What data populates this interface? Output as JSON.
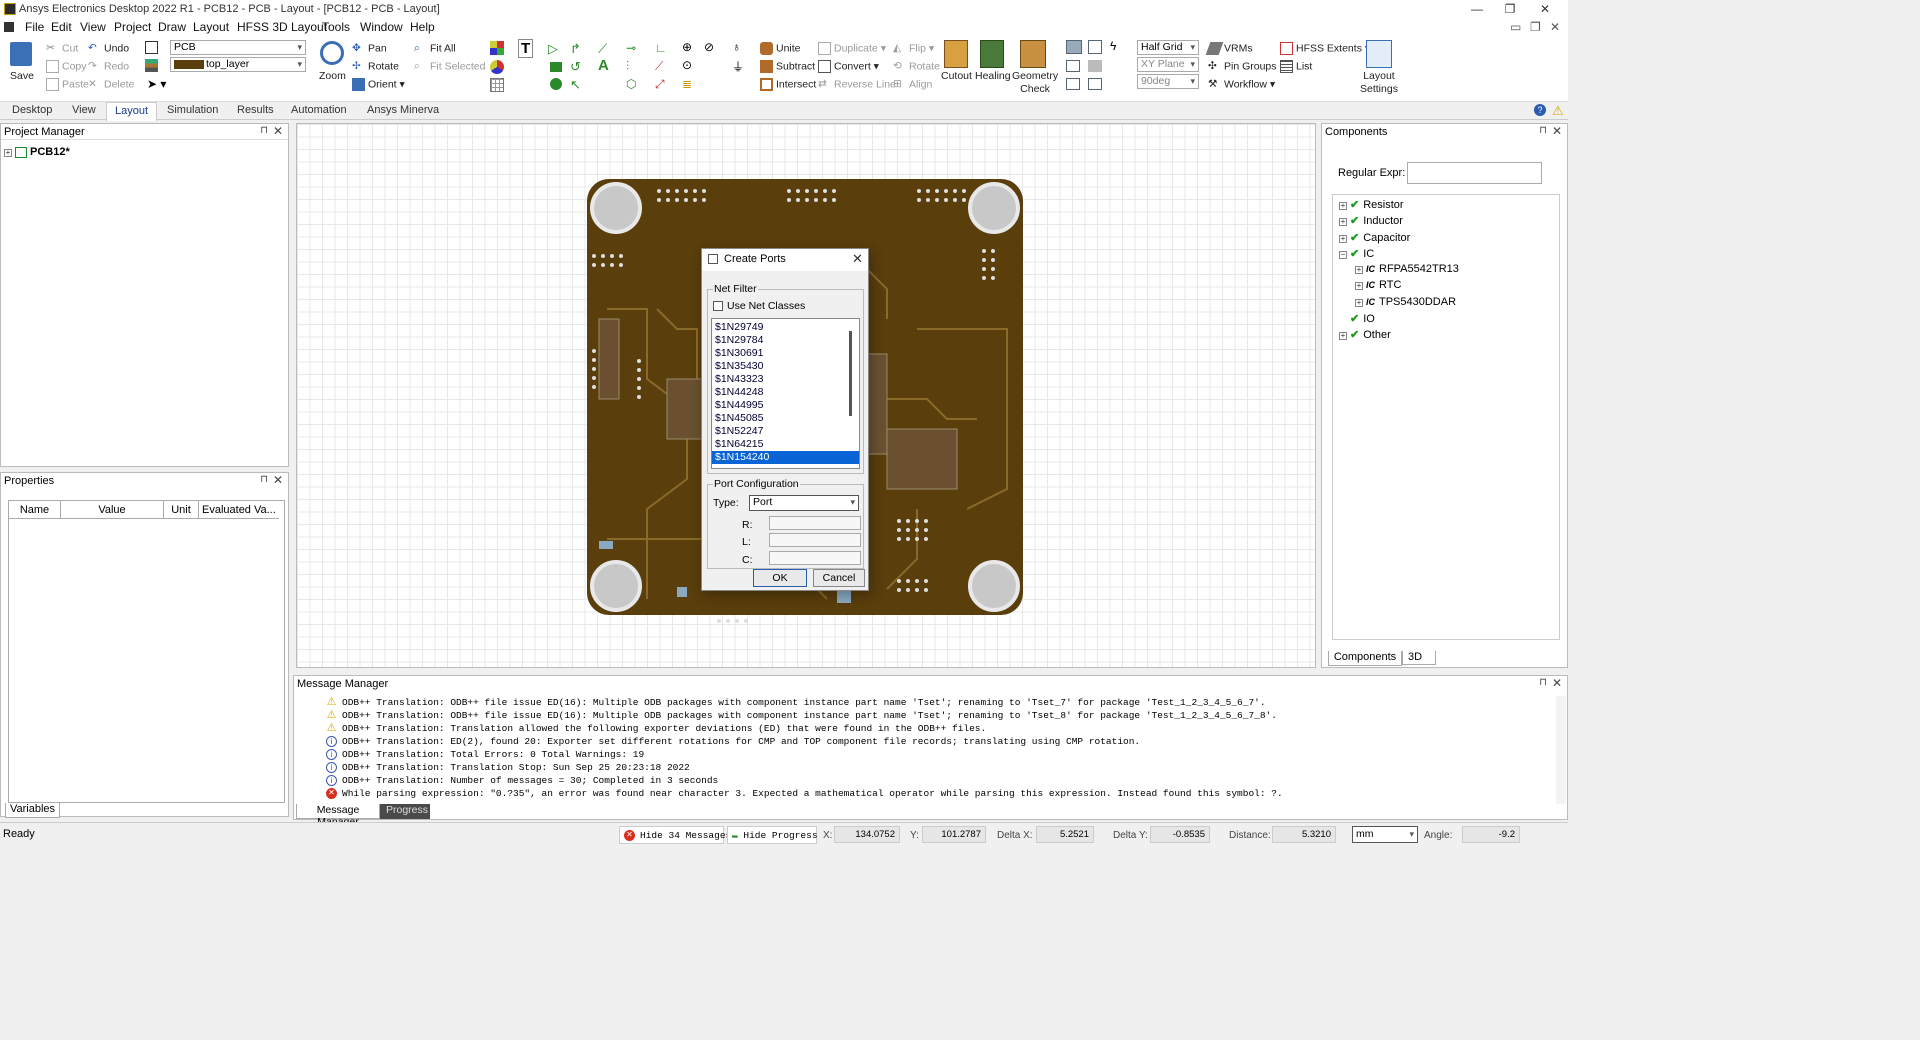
{
  "window": {
    "title": "Ansys Electronics Desktop 2022 R1 - PCB12 - PCB - Layout - [PCB12 - PCB - Layout]"
  },
  "menu": [
    "File",
    "Edit",
    "View",
    "Project",
    "Draw",
    "Layout",
    "HFSS 3D Layout",
    "Tools",
    "Window",
    "Help"
  ],
  "ribbon": {
    "save": "Save",
    "cut": "Cut",
    "copy": "Copy",
    "paste": "Paste",
    "undo": "Undo",
    "redo": "Redo",
    "delete": "Delete",
    "design_combo": "PCB",
    "layer_combo": "top_layer",
    "zoom": "Zoom",
    "pan": "Pan",
    "rotate": "Rotate",
    "orient": "Orient",
    "fit_all": "Fit All",
    "fit_selected": "Fit Selected",
    "unite": "Unite",
    "subtract": "Subtract",
    "intersect": "Intersect",
    "duplicate": "Duplicate",
    "convert": "Convert",
    "reverse_line": "Reverse Line",
    "flip": "Flip",
    "rotate2": "Rotate",
    "align": "Align",
    "cutout": "Cutout",
    "healing": "Healing",
    "geometry_check": "Geometry\nCheck",
    "grid_combo": "Half Grid",
    "plane_combo": "XY Plane",
    "angle_combo": "90deg",
    "vrms": "VRMs",
    "pin_groups": "Pin Groups",
    "workflow": "Workflow",
    "hfss_extents": "HFSS Extents",
    "list": "List",
    "layout_settings": "Layout\nSettings"
  },
  "tabs": [
    "Desktop",
    "View",
    "Layout",
    "Simulation",
    "Results",
    "Automation",
    "Ansys Minerva"
  ],
  "project_manager": {
    "title": "Project Manager",
    "root": "PCB12*"
  },
  "properties": {
    "title": "Properties",
    "columns": [
      "Name",
      "Value",
      "Unit",
      "Evaluated Va..."
    ],
    "tab": "Variables"
  },
  "components": {
    "title": "Components",
    "regex_label": "Regular Expr:",
    "tree": [
      {
        "label": "Resistor",
        "level": 0,
        "exp": "+"
      },
      {
        "label": "Inductor",
        "level": 0,
        "exp": "+"
      },
      {
        "label": "Capacitor",
        "level": 0,
        "exp": "+"
      },
      {
        "label": "IC",
        "level": 0,
        "exp": "−"
      },
      {
        "label": "RFPA5542TR13",
        "level": 1,
        "exp": "+"
      },
      {
        "label": "RTC",
        "level": 1,
        "exp": "+"
      },
      {
        "label": "TPS5430DDAR",
        "level": 1,
        "exp": "+"
      },
      {
        "label": "IO",
        "level": 0,
        "exp": ""
      },
      {
        "label": "Other",
        "level": 0,
        "exp": "+"
      }
    ],
    "tabs": [
      "Components",
      "3D"
    ]
  },
  "dialog": {
    "title": "Create Ports",
    "net_filter": "Net Filter",
    "use_net_classes": "Use Net Classes",
    "nets": [
      "$1N29749",
      "$1N29784",
      "$1N30691",
      "$1N35430",
      "$1N43323",
      "$1N44248",
      "$1N44995",
      "$1N45085",
      "$1N52247",
      "$1N64215",
      "$1N154240"
    ],
    "selected_net": "$1N154240",
    "port_config": "Port Configuration",
    "type_label": "Type:",
    "type_value": "Port",
    "r_label": "R:",
    "l_label": "L:",
    "c_label": "C:",
    "ok": "OK",
    "cancel": "Cancel"
  },
  "message_manager": {
    "title": "Message Manager",
    "messages": [
      {
        "type": "warn",
        "text": "ODB++ Translation: ODB++ file issue ED(16): Multiple ODB packages with component instance part name 'Tset'; renaming to 'Tset_7' for package 'Test_1_2_3_4_5_6_7'."
      },
      {
        "type": "warn",
        "text": "ODB++ Translation: ODB++ file issue ED(16): Multiple ODB packages with component instance part name 'Tset'; renaming to 'Tset_8' for package 'Test_1_2_3_4_5_6_7_8'."
      },
      {
        "type": "warn",
        "text": "ODB++ Translation: Translation allowed the following exporter deviations (ED) that were found in the ODB++ files."
      },
      {
        "type": "info",
        "text": "ODB++ Translation: ED(2), found 20: Exporter set different rotations for CMP and TOP component file records; translating using CMP rotation."
      },
      {
        "type": "info",
        "text": "ODB++ Translation: Total Errors: 0 Total Warnings: 19"
      },
      {
        "type": "info",
        "text": "ODB++ Translation: Translation Stop: Sun Sep 25 20:23:18 2022"
      },
      {
        "type": "info",
        "text": "ODB++ Translation: Number of messages = 30; Completed in 3 seconds"
      },
      {
        "type": "err",
        "text": "While parsing expression: \"0.?35\", an error was found near character 3. Expected a mathematical operator while parsing this expression. Instead found this symbol: ?."
      }
    ],
    "tabs": [
      "Message Manager",
      "Progress"
    ]
  },
  "status": {
    "ready": "Ready",
    "hide_messages": "Hide 34 Messages",
    "hide_progress": "Hide Progress",
    "x_label": "X:",
    "x": "134.0752",
    "y_label": "Y:",
    "y": "101.2787",
    "dx_label": "Delta X:",
    "dx": "5.2521",
    "dy_label": "Delta Y:",
    "dy": "-0.8535",
    "dist_label": "Distance:",
    "dist": "5.3210",
    "unit": "mm",
    "angle_label": "Angle:",
    "angle": "-9.2"
  }
}
